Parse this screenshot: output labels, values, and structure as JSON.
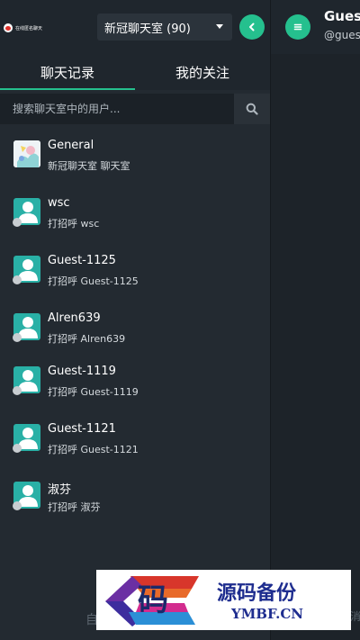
{
  "logo": {
    "text": "在线匿名聊天"
  },
  "room_select": {
    "value": "新冠聊天室 (90)"
  },
  "tabs": [
    {
      "label": "聊天记录",
      "active": true
    },
    {
      "label": "我的关注",
      "active": false
    }
  ],
  "search": {
    "placeholder": "搜索聊天室中的用户..."
  },
  "chats": [
    {
      "name": "General",
      "subtitle": "新冠聊天室 聊天室",
      "avatar": "room-image"
    },
    {
      "name": "wsc",
      "subtitle": "打招呼 wsc",
      "avatar": "user-icon"
    },
    {
      "name": "Guest-1125",
      "subtitle": "打招呼 Guest-1125",
      "avatar": "user-icon"
    },
    {
      "name": "Alren639",
      "subtitle": "打招呼 Alren639",
      "avatar": "user-icon"
    },
    {
      "name": "Guest-1119",
      "subtitle": "打招呼 Guest-1119",
      "avatar": "user-icon"
    },
    {
      "name": "Guest-1121",
      "subtitle": "打招呼 Guest-1121",
      "avatar": "user-icon"
    },
    {
      "name": "淑芬",
      "subtitle": "打招呼 淑芬",
      "avatar": "user-icon"
    }
  ],
  "main_header": {
    "title": "Gues",
    "handle": "@gues"
  },
  "footer": {
    "left_text": "自",
    "right_text": "消"
  },
  "watermark": {
    "char": "码",
    "title": "源码备份",
    "url": "YMBF.CN"
  },
  "colors": {
    "accent": "#25c08e",
    "avatar": "#29b0a6",
    "sidebar_bg": "#232a31",
    "header_bg": "#1f262d"
  }
}
